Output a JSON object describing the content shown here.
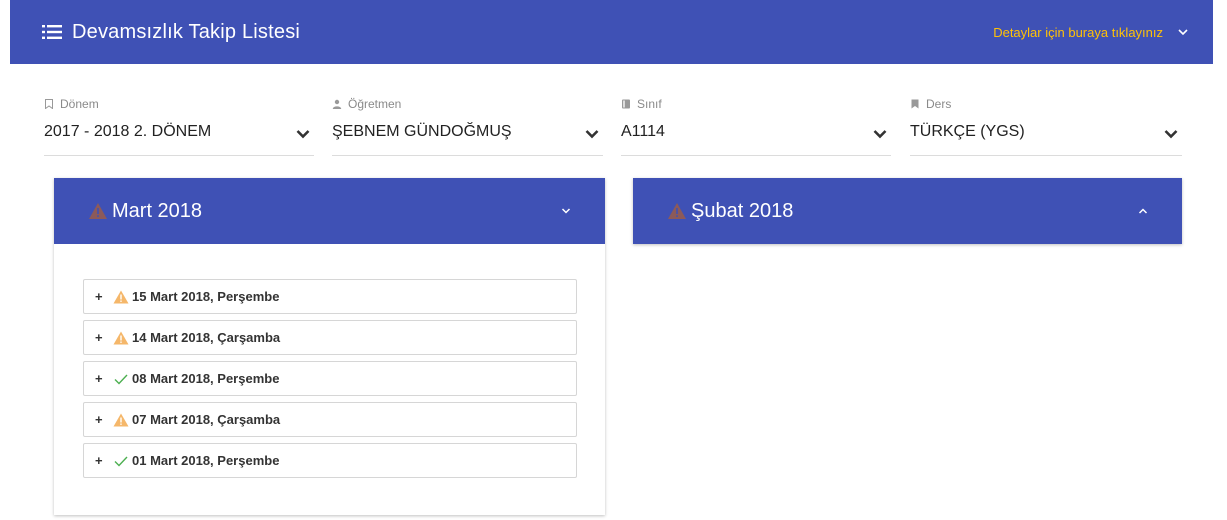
{
  "app": {
    "title": "Devamsızlık Takip Listesi",
    "details_link": "Detaylar için buraya tıklayınız"
  },
  "filters": [
    {
      "label": "Dönem",
      "icon": "bookmark-outline-icon",
      "value": "2017 - 2018 2. DÖNEM"
    },
    {
      "label": "Öğretmen",
      "icon": "person-icon",
      "value": "ŞEBNEM GÜNDOĞMUŞ"
    },
    {
      "label": "Sınıf",
      "icon": "book-icon",
      "value": "A1114"
    },
    {
      "label": "Ders",
      "icon": "bookmark-icon",
      "value": "TÜRKÇE (YGS)"
    }
  ],
  "months": [
    {
      "title": "Mart 2018",
      "status": "warning",
      "expanded": true,
      "days": [
        {
          "label": "15 Mart 2018, Perşembe",
          "status": "warning"
        },
        {
          "label": "14 Mart 2018, Çarşamba",
          "status": "warning"
        },
        {
          "label": "08 Mart 2018, Perşembe",
          "status": "ok"
        },
        {
          "label": "07 Mart 2018, Çarşamba",
          "status": "warning"
        },
        {
          "label": "01 Mart 2018, Perşembe",
          "status": "ok"
        }
      ]
    },
    {
      "title": "Şubat 2018",
      "status": "warning",
      "expanded": false,
      "days": []
    }
  ],
  "colors": {
    "primary": "#3f51b5",
    "accent": "#ffc107",
    "warning_icon": "#f5b76a",
    "month_warning_icon": "#8c5a5a",
    "ok_icon": "#4caf50"
  },
  "expand_symbol": "+"
}
